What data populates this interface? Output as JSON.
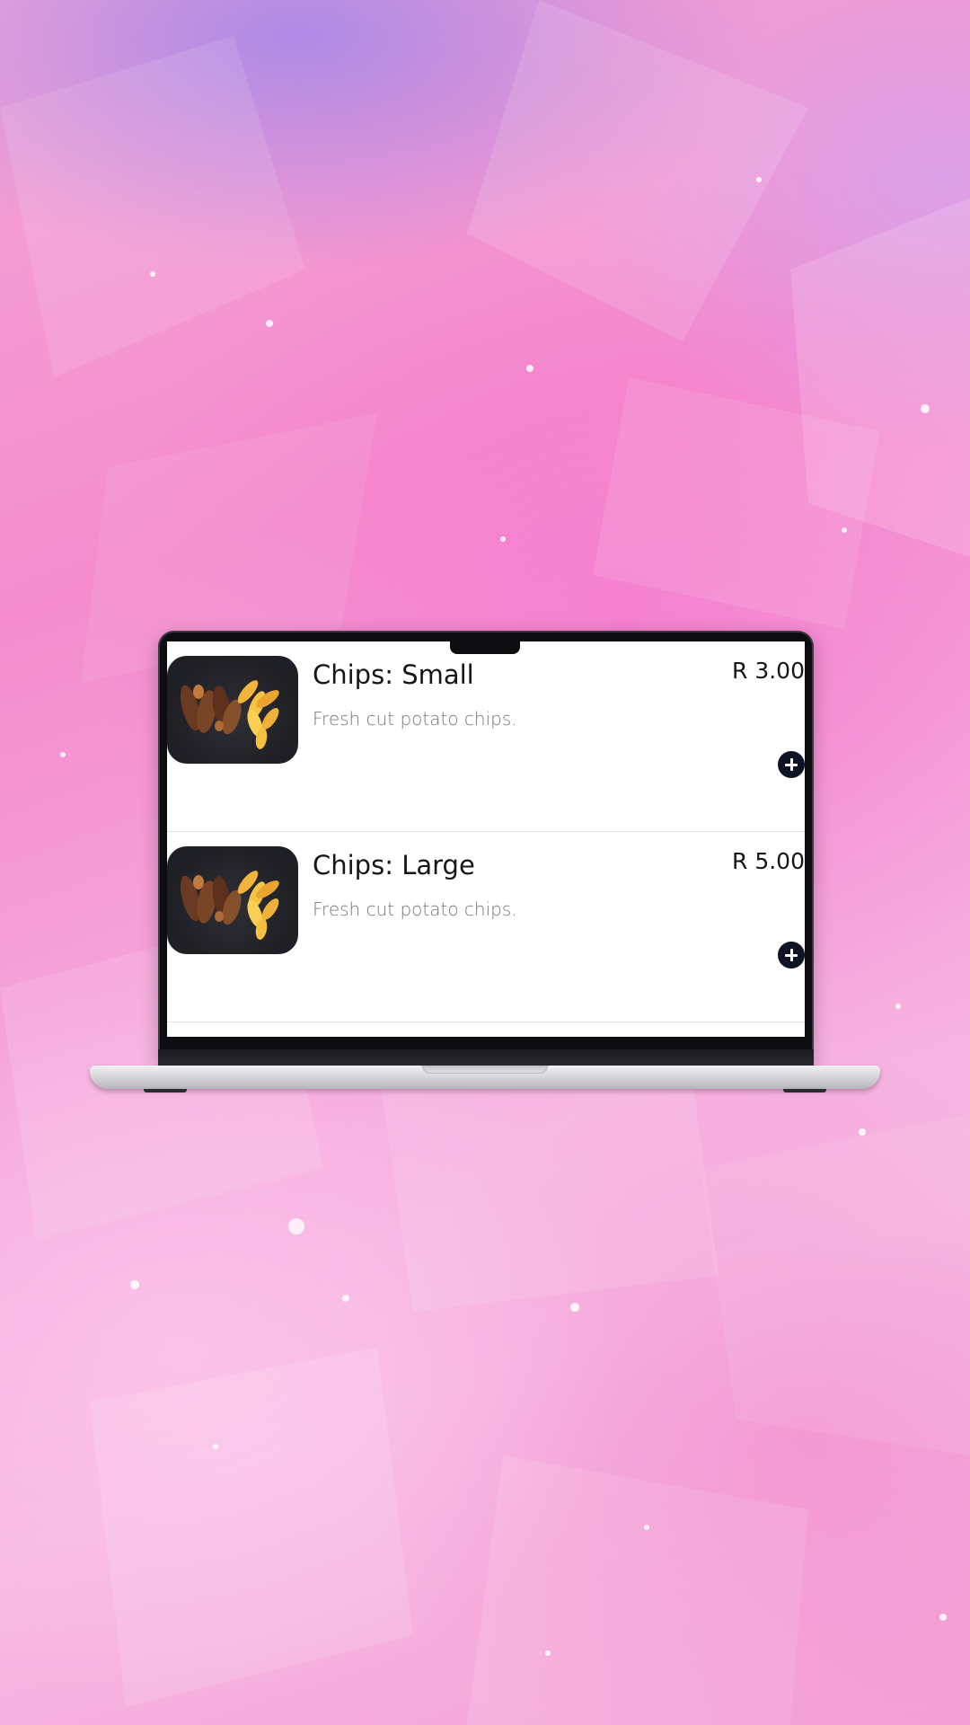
{
  "menu": {
    "items": [
      {
        "name": "Chips: Small",
        "description": "Fresh cut potato chips.",
        "price": "R 3.00",
        "image_icon": "chicken-wings-and-chips-image"
      },
      {
        "name": "Chips: Large",
        "description": "Fresh cut potato chips.",
        "price": "R 5.00",
        "image_icon": "chicken-wings-and-chips-image"
      }
    ],
    "add_icon": "plus-icon"
  },
  "colors": {
    "add_button": "#0f1424",
    "text_primary": "#16161a",
    "text_secondary": "#75757d",
    "background_pink": "#f48ccd",
    "background_purple": "#9682eb"
  }
}
